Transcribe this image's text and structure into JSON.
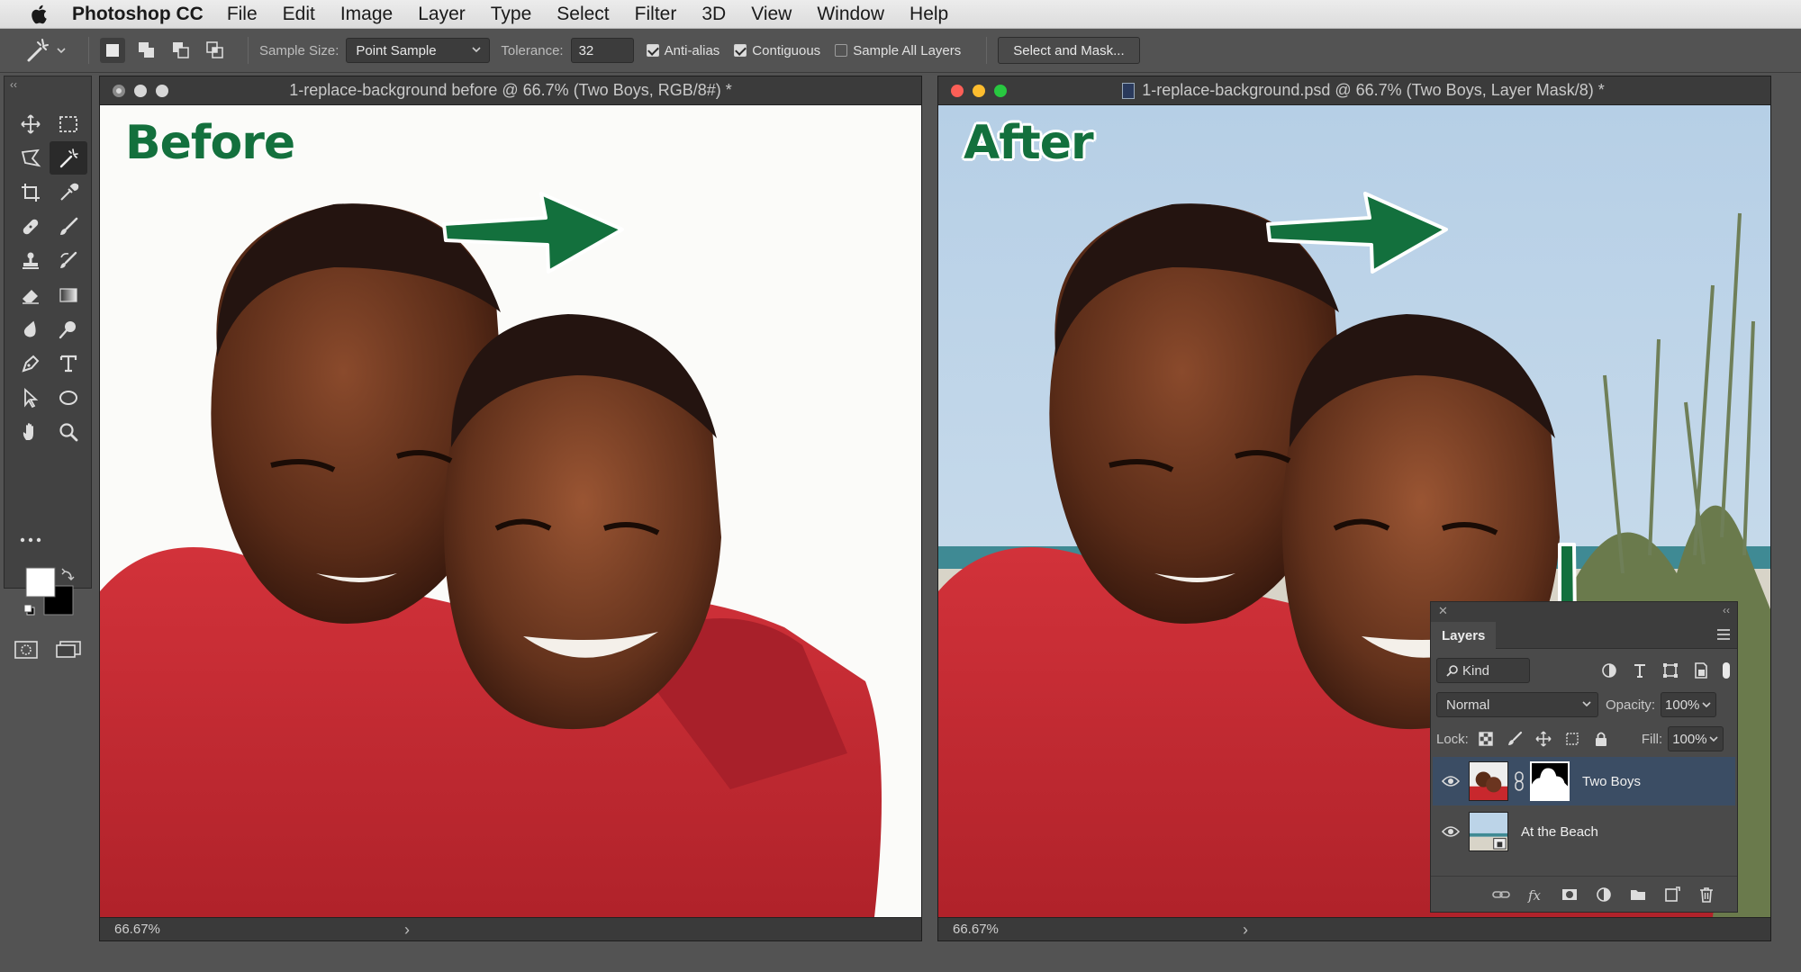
{
  "menubar": {
    "app": "Photoshop CC",
    "items": [
      "File",
      "Edit",
      "Image",
      "Layer",
      "Type",
      "Select",
      "Filter",
      "3D",
      "View",
      "Window",
      "Help"
    ]
  },
  "options": {
    "sample_size_label": "Sample Size:",
    "sample_size_value": "Point Sample",
    "tolerance_label": "Tolerance:",
    "tolerance_value": "32",
    "anti_alias": "Anti-alias",
    "contiguous": "Contiguous",
    "sample_all_layers": "Sample All Layers",
    "select_and_mask": "Select and Mask..."
  },
  "doc_before": {
    "title": "1-replace-background before @ 66.7% (Two Boys, RGB/8#) *",
    "caption": "Before",
    "zoom": "66.67%"
  },
  "doc_after": {
    "title": "1-replace-background.psd @ 66.7% (Two Boys, Layer Mask/8) *",
    "caption": "After",
    "zoom": "66.67%"
  },
  "layers_panel": {
    "tab": "Layers",
    "kind": "Kind",
    "blend_mode": "Normal",
    "opacity_label": "Opacity:",
    "opacity_value": "100%",
    "lock_label": "Lock:",
    "fill_label": "Fill:",
    "fill_value": "100%",
    "layers": [
      {
        "name": "Two Boys"
      },
      {
        "name": "At the Beach"
      }
    ]
  },
  "colors": {
    "accent_green": "#13703d",
    "selection_blue": "#3b4d64",
    "shirt_red": "#c8282d"
  }
}
